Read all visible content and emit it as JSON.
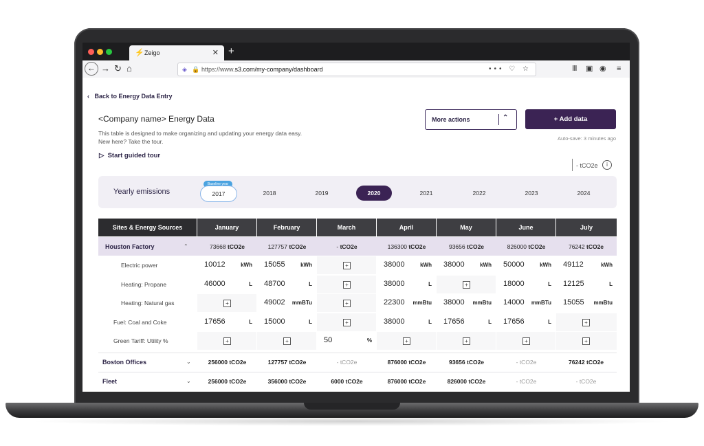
{
  "browser": {
    "tab_title": "Zeigo",
    "url_prefix": "https://www.",
    "url_host_path": "s3.com/my-company/dashboard"
  },
  "page": {
    "back_label": "Back to Energy Data Entry",
    "title": "<Company name> Energy Data",
    "description_line1": "This table is designed to make organizing and updating your energy data easy.",
    "description_line2": "New here? Take the tour.",
    "tour_label": "Start guided tour",
    "more_actions_label": "More actions",
    "add_data_label": "+ Add data",
    "autosave": "Auto-save: 3 minutes ago",
    "unit_toggle": "- tCO2e",
    "yearly_label": "Yearly emissions",
    "baseline_badge": "Baseline year",
    "years": [
      "2017",
      "2018",
      "2019",
      "2020",
      "2021",
      "2022",
      "2023",
      "2024"
    ]
  },
  "table": {
    "first_header": "Sites & Energy Sources",
    "months": [
      "January",
      "February",
      "March",
      "April",
      "May",
      "June",
      "July"
    ],
    "houston": {
      "name": "Houston Factory",
      "totals": [
        {
          "num": "73668",
          "unit": "tCO2e"
        },
        {
          "num": "127757",
          "unit": "tCO2e"
        },
        {
          "num": "-",
          "unit": "tCO2e"
        },
        {
          "num": "136300",
          "unit": "tCO2e"
        },
        {
          "num": "93656",
          "unit": "tCO2e"
        },
        {
          "num": "826000",
          "unit": "tCO2e"
        },
        {
          "num": "76242",
          "unit": "tCO2e"
        }
      ]
    },
    "sources": [
      {
        "name": "Electric power",
        "cells": [
          [
            "10012",
            "kWh"
          ],
          [
            "15055",
            "kWh"
          ],
          null,
          [
            "38000",
            "kWh"
          ],
          [
            "38000",
            "kWh"
          ],
          [
            "50000",
            "kWh"
          ],
          [
            "49112",
            "kWh"
          ]
        ]
      },
      {
        "name": "Heating:  Propane",
        "cells": [
          [
            "46000",
            "L"
          ],
          [
            "48700",
            "L"
          ],
          null,
          [
            "38000",
            "L"
          ],
          null,
          [
            "18000",
            "L"
          ],
          [
            "12125",
            "L"
          ]
        ]
      },
      {
        "name": "Heating: Natural gas",
        "cells": [
          null,
          [
            "49002",
            "mmBTu"
          ],
          null,
          [
            "22300",
            "mmBtu"
          ],
          [
            "38000",
            "mmBtu"
          ],
          [
            "14000",
            "mmBTu"
          ],
          [
            "15055",
            "mmBtu"
          ]
        ]
      },
      {
        "name": "Fuel: Coal and Coke",
        "cells": [
          [
            "17656",
            "L"
          ],
          [
            "15000",
            "L"
          ],
          null,
          [
            "38000",
            "L"
          ],
          [
            "17656",
            "L"
          ],
          [
            "17656",
            "L"
          ],
          null
        ]
      },
      {
        "name": "Green Tariff: Utility %",
        "cells": [
          null,
          null,
          [
            "50",
            "%"
          ],
          null,
          null,
          null,
          null
        ]
      }
    ],
    "other_sites": [
      {
        "name": "Boston Offices",
        "totals": [
          [
            "256000",
            "tCO2e"
          ],
          [
            "127757",
            "tCO2e"
          ],
          [
            "-",
            "tCO2e"
          ],
          [
            "876000",
            "tCO2e"
          ],
          [
            "93656",
            "tCO2e"
          ],
          [
            "-",
            "tCO2e"
          ],
          [
            "76242",
            "tCO2e"
          ]
        ]
      },
      {
        "name": "Fleet",
        "totals": [
          [
            "256000",
            "tCO2e"
          ],
          [
            "356000",
            "tCO2e"
          ],
          [
            "6000",
            "tCO2e"
          ],
          [
            "876000",
            "tCO2e"
          ],
          [
            "826000",
            "tCO2e"
          ],
          [
            "-",
            "tCO2e"
          ],
          [
            "-",
            "tCO2e"
          ]
        ]
      }
    ]
  }
}
